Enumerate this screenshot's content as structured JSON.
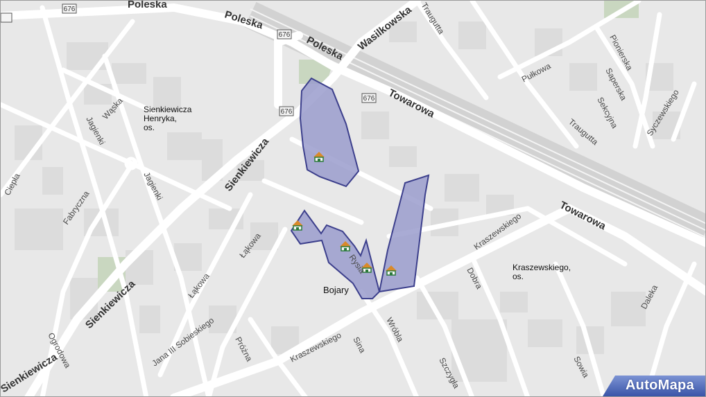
{
  "map": {
    "streets": {
      "poleska_top": "Poleska",
      "poleska_mid": "Poleska",
      "poleska_center": "Poleska",
      "wasilkowska": "Wasilkowska",
      "towarowa_top": "Towarowa",
      "towarowa_right": "Towarowa",
      "traugutta_top": "Traugutta",
      "traugutta_mid": "Traugutta",
      "pulkowa": "Pułkowa",
      "pionierska": "Pionierska",
      "saperska": "Saperska",
      "sekcyjna": "Sekcyjna",
      "syczewskiego": "Syczewskiego",
      "waska": "Wąska",
      "jagienki_top": "Jagienki",
      "jagienki_bottom": "Jagienki",
      "ciepla": "Ciepła",
      "fabryczna": "Fabryczna",
      "sienkiewicza_top": "Sienkiewicza",
      "sienkiewicza_mid": "Sienkiewicza",
      "sienkiewicza_bottom": "Sienkiewicza",
      "lakowa_top": "Łąkowa",
      "lakowa_bottom": "Łąkowa",
      "ogrodowa": "Ogrodowa",
      "jana_sobieskiego": "Jana III Sobieskiego",
      "prozna": "Próżna",
      "kraszewskiego_bottom": "Kraszewskiego",
      "kraszewskiego_right": "Kraszewskiego",
      "sina": "Sina",
      "wrobla": "Wróbla",
      "szczygla": "Szczygła",
      "dobra": "Dobra",
      "sowia": "Sowia",
      "daleka": "Daleka",
      "rysia": "Rysia"
    },
    "routes": [
      "676",
      "676",
      "676",
      "676"
    ],
    "places": {
      "sienkiewicza_os_line1": "Sienkiewicza",
      "sienkiewicza_os_line2": "Henryka,",
      "sienkiewicza_os_line3": "os.",
      "kraszewskiego_os_line1": "Kraszewskiego,",
      "kraszewskiego_os_line2": "os.",
      "bojary": "Bojary"
    },
    "colors": {
      "background": "#e8e8e8",
      "road": "#ffffff",
      "highlight_fill": "#9a9ccc",
      "highlight_stroke": "#3c3f8c",
      "railway": "#d2d2d2",
      "green": "#c9d7c0"
    },
    "markers": [
      "house-icon",
      "house-icon",
      "house-icon",
      "house-icon",
      "house-icon"
    ]
  },
  "branding": {
    "logo": "AutoMapa"
  }
}
